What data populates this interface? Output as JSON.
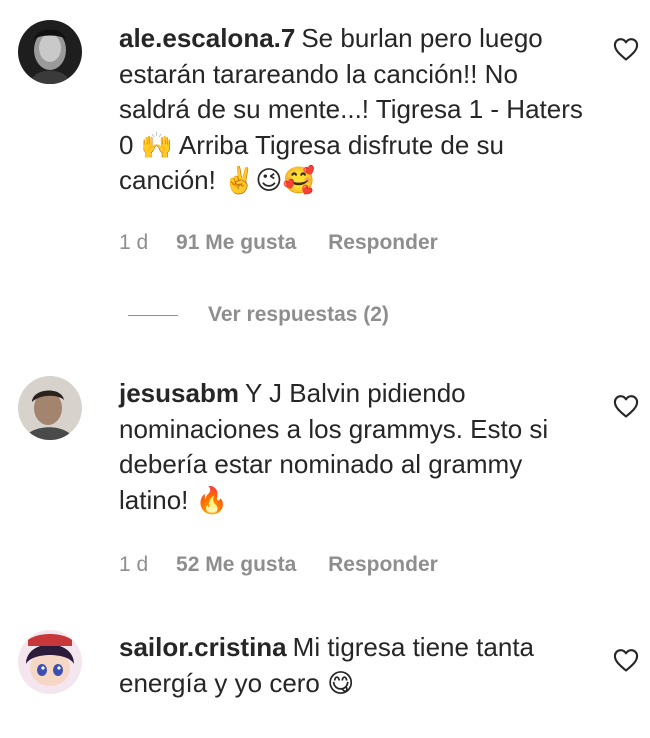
{
  "comments": [
    {
      "username": "ale.escalona.7",
      "text": "Se burlan pero luego estarán tarareando la canción!! No saldrá de su mente...! Tigresa 1 - Haters 0 🙌 Arriba Tigresa disfrute de su canción! ✌️😉🥰",
      "time": "1 d",
      "likes": "91 Me gusta",
      "reply": "Responder",
      "view_replies": "Ver respuestas (2)"
    },
    {
      "username": "jesusabm",
      "text": "Y J Balvin pidiendo nominaciones a los grammys. Esto si debería estar nominado al grammy latino! 🔥",
      "time": "1 d",
      "likes": "52 Me gusta",
      "reply": "Responder"
    },
    {
      "username": "sailor.cristina",
      "text": "Mi tigresa tiene tanta energía y yo cero 😋"
    }
  ],
  "icons": {
    "like": "heart-outline-icon"
  }
}
